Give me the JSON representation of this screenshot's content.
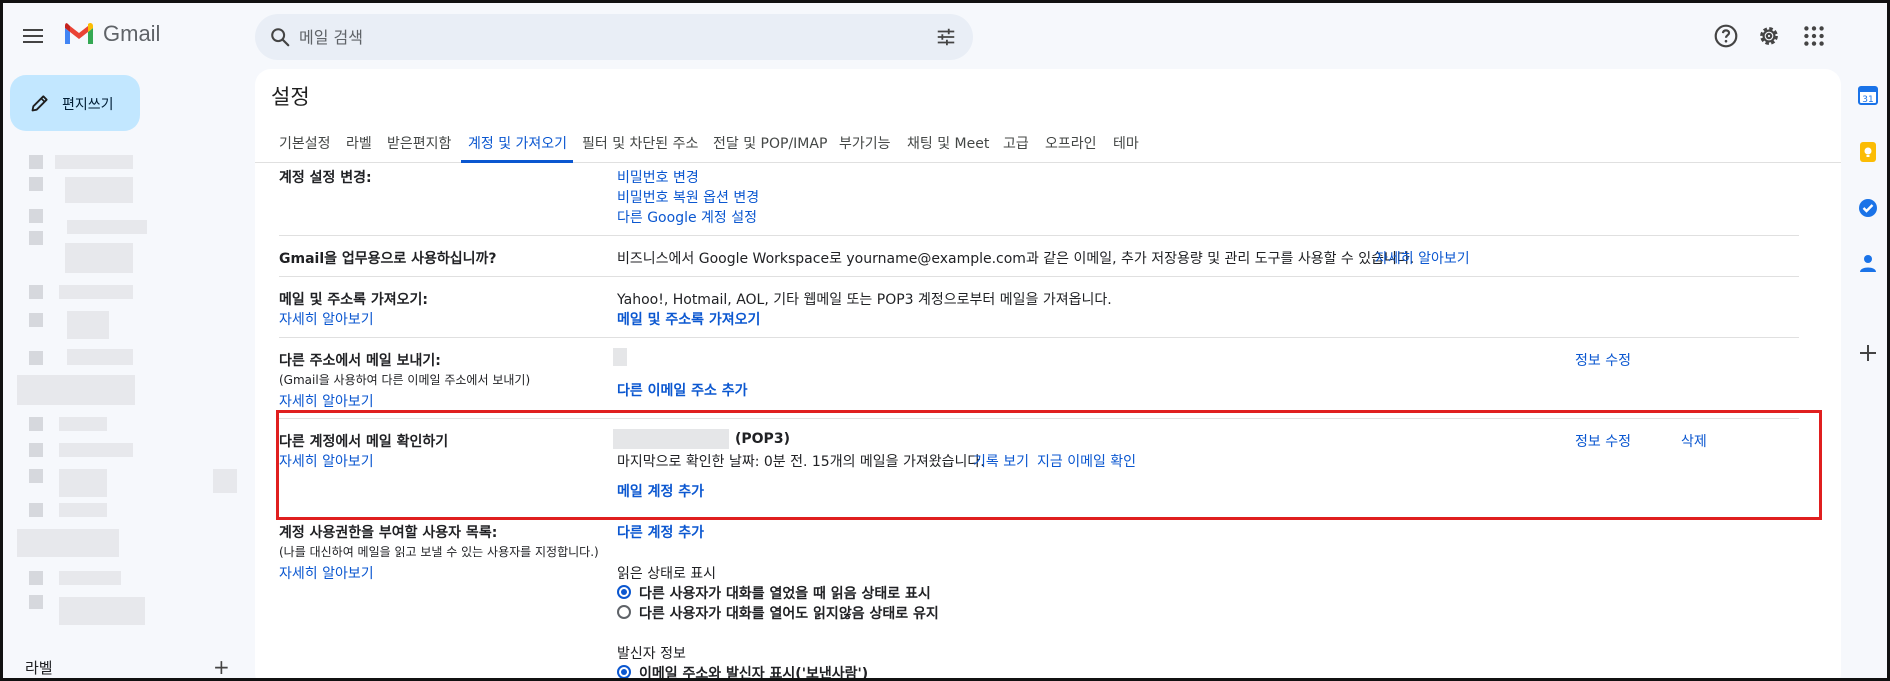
{
  "header": {
    "app_name": "Gmail",
    "search_placeholder": "메일 검색"
  },
  "compose": {
    "label": "편지쓰기"
  },
  "sidebar": {
    "labels_title": "라벨",
    "labels_add": "+"
  },
  "settings": {
    "title": "설정",
    "tabs": [
      {
        "label": "기본설정"
      },
      {
        "label": "라벨"
      },
      {
        "label": "받은편지함"
      },
      {
        "label": "계정 및 가져오기",
        "active": true
      },
      {
        "label": "필터 및 차단된 주소"
      },
      {
        "label": "전달 및 POP/IMAP"
      },
      {
        "label": "부가기능"
      },
      {
        "label": "채팅 및 Meet"
      },
      {
        "label": "고급"
      },
      {
        "label": "오프라인"
      },
      {
        "label": "테마"
      }
    ],
    "change_account": {
      "label": "계정 설정 변경:",
      "links": [
        "비밀번호 변경",
        "비밀번호 복원 옵션 변경",
        "다른 Google 계정 설정"
      ]
    },
    "business": {
      "label": "Gmail을 업무용으로 사용하십니까?",
      "text": "비즈니스에서 Google Workspace로 yourname@example.com과 같은 이메일, 추가 저장용량 및 관리 도구를 사용할 수 있습니다.",
      "link": "자세히 알아보기"
    },
    "import": {
      "label": "메일 및 주소록 가져오기:",
      "learn_more": "자세히 알아보기",
      "text": "Yahoo!, Hotmail, AOL, 기타 웹메일 또는 POP3 계정으로부터 메일을 가져옵니다.",
      "action": "메일 및 주소록 가져오기"
    },
    "send_as": {
      "label": "다른 주소에서 메일 보내기:",
      "sub": "(Gmail을 사용하여 다른 이메일 주소에서 보내기)",
      "learn_more": "자세히 알아보기",
      "edit": "정보 수정",
      "action": "다른 이메일 주소 추가"
    },
    "check_mail": {
      "label": "다른 계정에서 메일 확인하기",
      "learn_more": "자세히 알아보기",
      "account_type": "(POP3)",
      "status": "마지막으로 확인한 날짜: 0분 전. 15개의 메일을 가져왔습니다.",
      "history": "기록 보기",
      "check_now": "지금 이메일 확인",
      "edit": "정보 수정",
      "delete": "삭제",
      "action": "메일 계정 추가"
    },
    "grant_access": {
      "label": "계정 사용권한을 부여할 사용자 목록:",
      "sub": "(나를 대신하여 메일을 읽고 보낼 수 있는 사용자를 지정합니다.)",
      "learn_more": "자세히 알아보기",
      "action": "다른 계정 추가",
      "read_status_title": "읽은 상태로 표시",
      "read_options": [
        {
          "label": "다른 사용자가 대화를 열었을 때 읽음 상태로 표시",
          "selected": true
        },
        {
          "label": "다른 사용자가 대화를 열어도 읽지않음 상태로 유지",
          "selected": false
        }
      ],
      "sender_info_title": "발신자 정보",
      "sender_options": [
        {
          "label": "이메일 주소와 발신자 표시('보낸사람')",
          "selected": true
        }
      ]
    }
  },
  "colors": {
    "link": "#0b57d0",
    "highlight": "#e01f1f",
    "compose_bg": "#c2e7ff",
    "page_bg": "#f6f8fc"
  }
}
